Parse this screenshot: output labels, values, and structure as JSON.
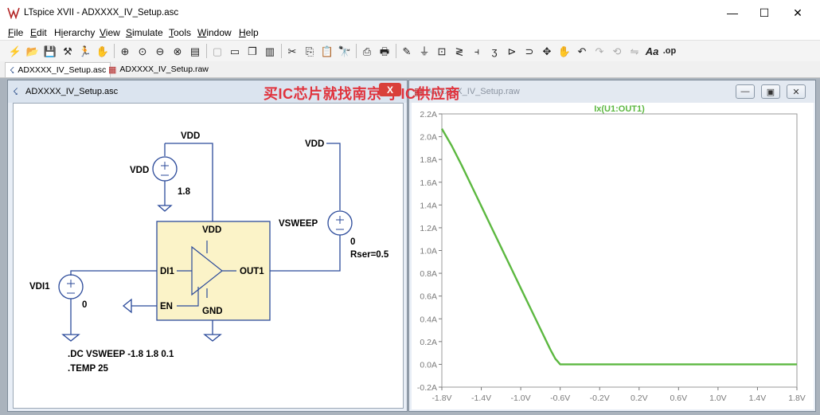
{
  "app": {
    "title": "LTspice XVII - ADXXXX_IV_Setup.asc"
  },
  "window_controls": {
    "minimize": "—",
    "maximize": "☐",
    "close": "✕"
  },
  "menu": [
    {
      "label": "File",
      "key": "F"
    },
    {
      "label": "Edit",
      "key": "E"
    },
    {
      "label": "Hierarchy",
      "key": "i"
    },
    {
      "label": "View",
      "key": "V"
    },
    {
      "label": "Simulate",
      "key": "S"
    },
    {
      "label": "Tools",
      "key": "T"
    },
    {
      "label": "Window",
      "key": "W"
    },
    {
      "label": "Help",
      "key": "H"
    }
  ],
  "toolbar": {
    "icons": [
      "new-schematic-icon",
      "open-folder-icon",
      "save-icon",
      "control-panel-icon",
      "run-icon",
      "pan-hand-icon",
      "zoom-in-icon",
      "zoom-rubber-icon",
      "zoom-out-icon",
      "zoom-fit-icon",
      "autorange-icon",
      "grayed-icon",
      "tile-horizontal-icon",
      "cascade-icon",
      "tile-vertical-icon",
      "cut-icon",
      "copy-icon",
      "paste-icon",
      "find-icon",
      "print-setup-icon",
      "print-icon",
      "draw-wire-icon",
      "ground-icon",
      "label-net-icon",
      "resistor-icon",
      "capacitor-icon",
      "inductor-icon",
      "diode-icon",
      "component-icon",
      "move-icon",
      "drag-icon",
      "undo-icon",
      "redo-icon",
      "rotate-icon",
      "mirror-icon",
      "text-icon",
      "spice-directive-icon"
    ],
    "text_button": "Aa",
    "op_button": ".op"
  },
  "tabs": [
    {
      "label": "ADXXXX_IV_Setup.asc",
      "active": true
    },
    {
      "label": "ADXXXX_IV_Setup.raw",
      "active": false
    }
  ],
  "schematic": {
    "window_title": "ADXXXX_IV_Setup.asc",
    "labels": {
      "vdd_top": "VDD",
      "vdd_source": "VDD",
      "vdd_value": "1.8",
      "vdd_right": "VDD",
      "vsweep": "VSWEEP",
      "vsweep_value": "0",
      "rser": "Rser=0.5",
      "vdi1": "VDI1",
      "vdi1_value": "0",
      "chip_vdd": "VDD",
      "chip_di1": "DI1",
      "chip_out1": "OUT1",
      "chip_en": "EN",
      "chip_gnd": "GND",
      "directive_dc": ".DC VSWEEP -1.8 1.8 0.1",
      "directive_temp": ".TEMP 25"
    }
  },
  "plot_window": {
    "title": "ADXXXX_IV_Setup.raw",
    "watermark": "买IC芯片就找南京 子IC供应商",
    "watermark_close": "X"
  },
  "chart_data": {
    "type": "line",
    "title": "Ix(U1:OUT1)",
    "xlabel": "",
    "ylabel": "",
    "xlim": [
      -1.8,
      1.8
    ],
    "ylim": [
      -0.2,
      2.2
    ],
    "xticks": [
      "-1.8V",
      "-1.4V",
      "-1.0V",
      "-0.6V",
      "-0.2V",
      "0.2V",
      "0.6V",
      "1.0V",
      "1.4V",
      "1.8V"
    ],
    "yticks": [
      "-0.2A",
      "0.0A",
      "0.2A",
      "0.4A",
      "0.6A",
      "0.8A",
      "1.0A",
      "1.2A",
      "1.4A",
      "1.6A",
      "1.8A",
      "2.0A",
      "2.2A"
    ],
    "grid": false,
    "color": "#5cb840",
    "series": [
      {
        "name": "Ix(U1:OUT1)",
        "x": [
          -1.8,
          -1.7,
          -1.6,
          -1.5,
          -1.4,
          -1.3,
          -1.2,
          -1.1,
          -1.0,
          -0.9,
          -0.8,
          -0.7,
          -0.65,
          -0.6,
          -0.2,
          0.2,
          0.6,
          1.0,
          1.4,
          1.8
        ],
        "y": [
          2.07,
          1.92,
          1.75,
          1.57,
          1.39,
          1.21,
          1.03,
          0.85,
          0.67,
          0.49,
          0.31,
          0.13,
          0.05,
          0.0,
          0.0,
          0.0,
          0.0,
          0.0,
          0.0,
          0.0
        ]
      }
    ]
  }
}
